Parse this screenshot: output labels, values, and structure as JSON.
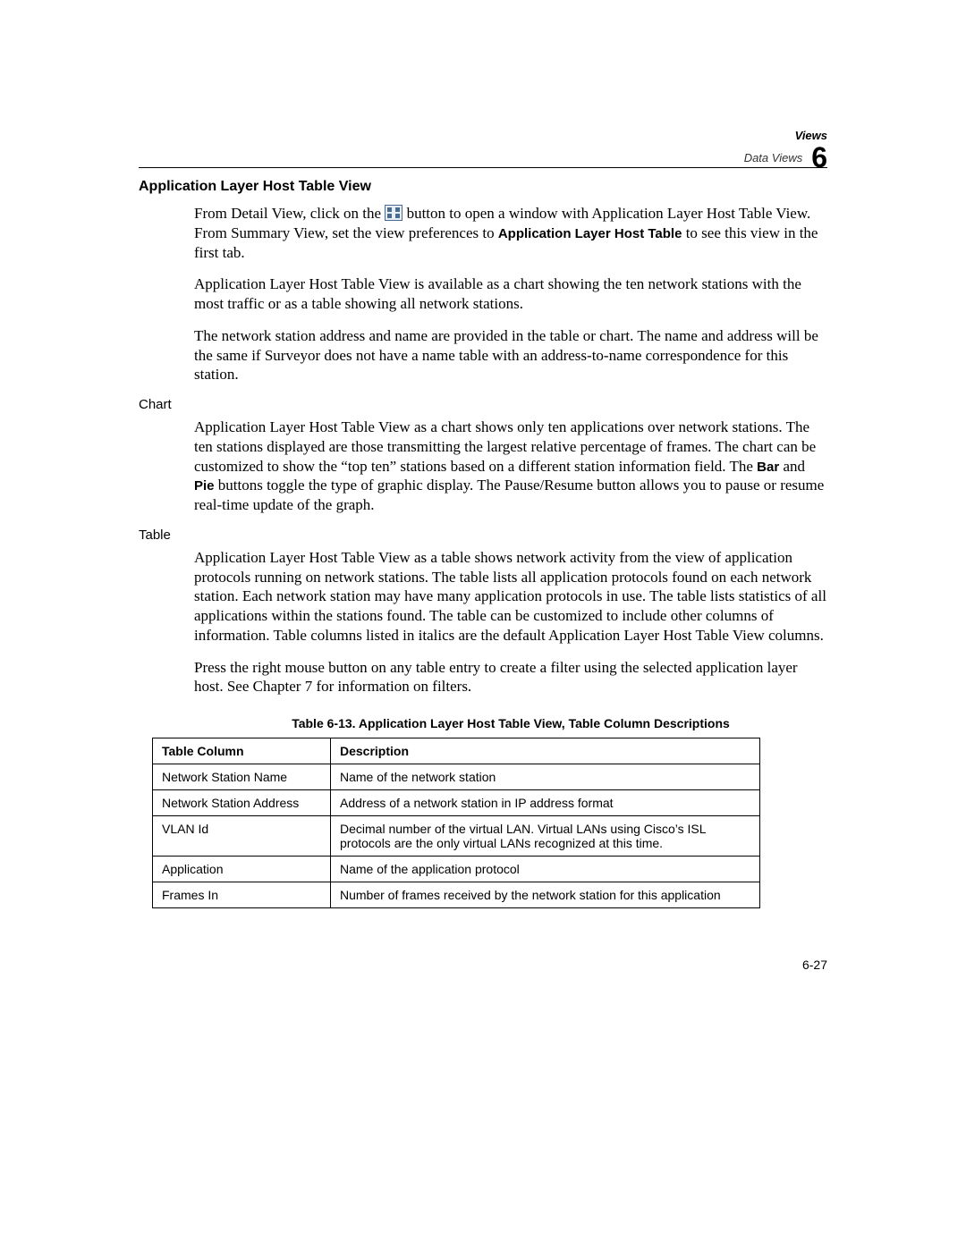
{
  "header": {
    "chapter": "Views",
    "section": "Data Views",
    "number": "6"
  },
  "headings": {
    "main": "Application Layer Host Table View",
    "chart": "Chart",
    "table": "Table"
  },
  "paras": {
    "p1a": "From Detail View, click on the ",
    "p1b": " button to open a window with Application Layer Host Table View. From Summary View, set the view preferences to ",
    "p1_bold": "Application Layer Host Table",
    "p1c": " to see this view in the first tab.",
    "p2": "Application Layer Host Table View is available as a chart showing the ten network stations with the most traffic or as a table showing all network stations.",
    "p3": "The network station address and name are provided in the table or chart. The name and address will be the same if Surveyor does not have a name table with an address-to-name correspondence for this station.",
    "p4a": "Application Layer Host Table View as a chart shows only ten applications over network stations. The ten stations displayed are those transmitting the largest relative percentage of frames. The chart can be customized to show the “top ten” stations based on a different station information field. The ",
    "p4_bar": "Bar",
    "p4_mid": " and ",
    "p4_pie": "Pie",
    "p4b": " buttons toggle the type of graphic display. The Pause/Resume button allows you to pause or resume real-time update of the graph.",
    "p5": "Application Layer Host Table View as a table shows network activity from the view of application protocols running on network stations. The table lists all application protocols found on each network station. Each network station may have many application protocols in use. The table lists statistics of all applications within the stations found. The table can be customized to include other columns of information. Table columns listed in italics are the default Application Layer Host Table View columns.",
    "p6": "Press the right mouse button on any table entry to create a filter using the selected application layer host. See Chapter 7 for information on filters."
  },
  "table": {
    "caption": "Table 6-13. Application Layer Host Table View, Table Column Descriptions",
    "h1": "Table Column",
    "h2": "Description",
    "rows": [
      {
        "c1": "Network Station Name",
        "c2": "Name of the network station"
      },
      {
        "c1": "Network Station Address",
        "c2": "Address of a network station in IP address format"
      },
      {
        "c1": "VLAN Id",
        "c2": "Decimal number of the virtual LAN. Virtual LANs using Cisco’s ISL protocols are the only virtual LANs recognized at this time."
      },
      {
        "c1": "Application",
        "c2": "Name of the application protocol"
      },
      {
        "c1": "Frames In",
        "c2": "Number of frames received by the network station for this application"
      }
    ]
  },
  "footer": {
    "page": "6-27"
  }
}
